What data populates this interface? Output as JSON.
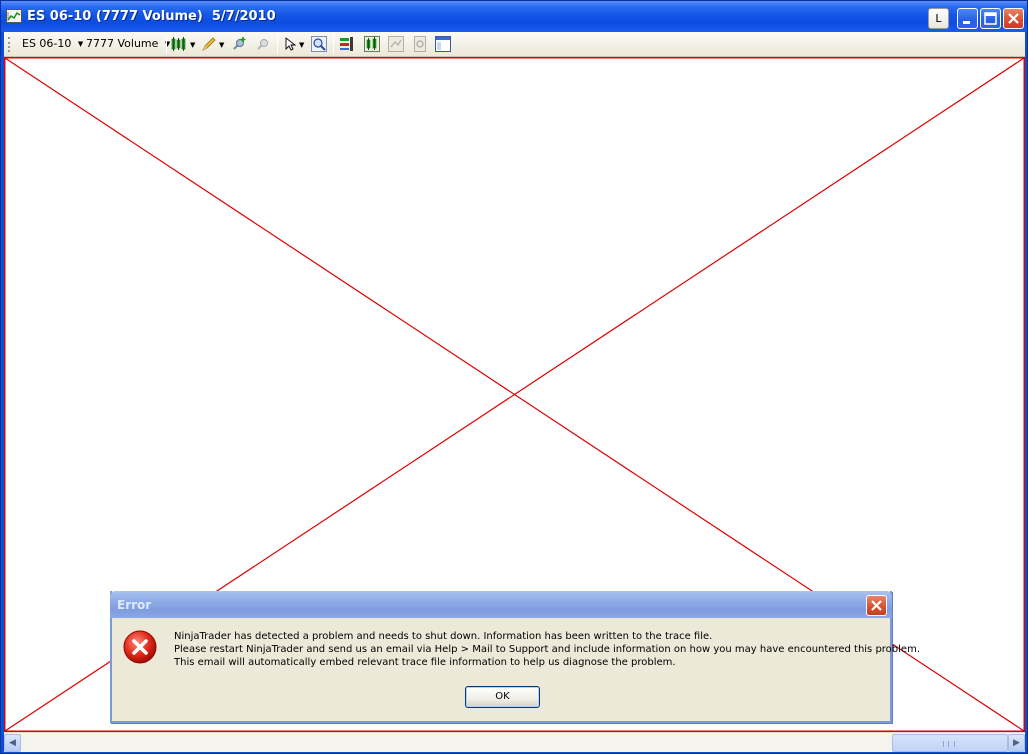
{
  "window": {
    "title": "ES 06-10 (7777 Volume)  5/7/2010",
    "link_button_label": "L"
  },
  "toolbar": {
    "instrument": "ES 06-10",
    "interval": "7777 Volume",
    "icons": [
      "chart-style-icon",
      "drawing-tool-icon",
      "pin-add-icon",
      "pin-remove-icon",
      "cursor-icon",
      "zoom-icon",
      "strategies-icon",
      "indicators-icon",
      "data-box-icon",
      "properties-icon",
      "panel-icon"
    ]
  },
  "chart": {
    "placeholder": "error-cross",
    "accent": "#dd0000"
  },
  "dialog": {
    "title": "Error",
    "lines": [
      "NinjaTrader has detected a problem and needs to shut down. Information has been written to the trace file.",
      "Please restart NinjaTrader and send us an email via Help > Mail to Support and include information on how you may have encountered this problem.",
      "This email will automatically embed relevant trace file information to help us diagnose the problem."
    ],
    "ok_label": "OK"
  }
}
